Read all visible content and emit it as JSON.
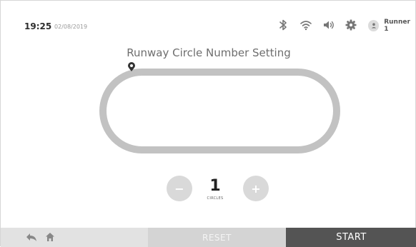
{
  "status_bar": {
    "time": "19:25",
    "date": "02/08/2019",
    "icons": [
      "bluetooth-icon",
      "wifi-icon",
      "volume-icon",
      "gear-icon"
    ],
    "user": {
      "avatar_icon": "user-icon",
      "name": "Runner 1"
    }
  },
  "main": {
    "title": "Runway Circle Number Setting",
    "track": {
      "marker_icon": "location-pin-icon"
    },
    "counter": {
      "value": "1",
      "unit": "CIRCLES",
      "decrement_label": "−",
      "increment_label": "+"
    }
  },
  "bottom_bar": {
    "back_icon": "back-arrow-icon",
    "home_icon": "home-icon",
    "reset_label": "RESET",
    "start_label": "START"
  },
  "colors": {
    "track": "#c2c2c2",
    "start_bg": "#545454",
    "reset_bg": "#d4d4d4",
    "nav_bg": "#e2e2e2",
    "round_button": "#d9d9d9"
  }
}
